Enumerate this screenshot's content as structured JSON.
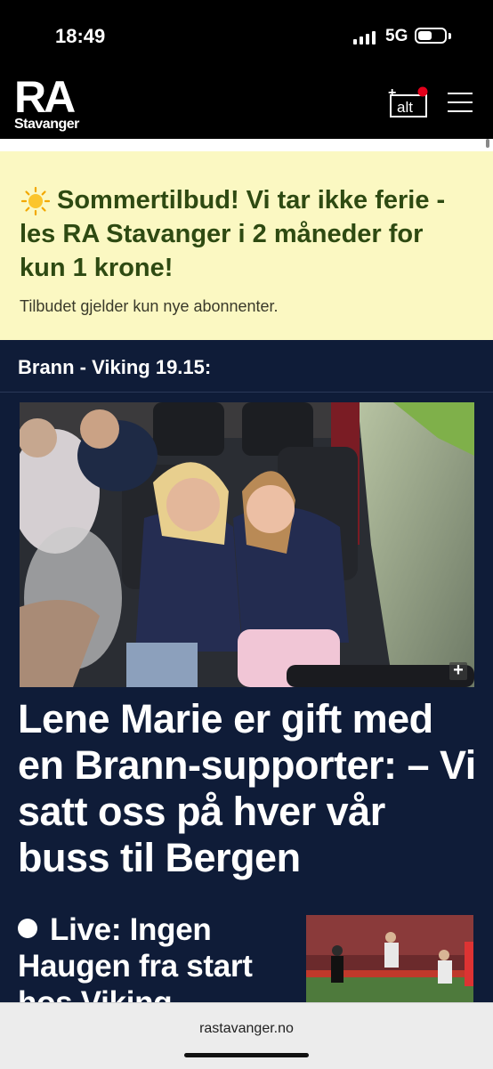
{
  "status_bar": {
    "time": "18:49",
    "network": "5G",
    "battery_level": 0.55
  },
  "header": {
    "logo_main": "RA",
    "logo_sub": "Stavanger",
    "alt_label": "alt",
    "alt_plus": "+",
    "menu_icon": "hamburger-menu-icon"
  },
  "promo": {
    "icon": "sun-icon",
    "title": "Sommertilbud! Vi tar ikke ferie - les RA Stavanger i 2 måneder for kun 1 krone!",
    "subtitle": "Tilbudet gjelder kun nye abonnenter.",
    "colors": {
      "background": "#fbf8c2",
      "title": "#2e4a12"
    }
  },
  "section": {
    "title": "Brann - Viking 19.15:",
    "background": "#0f1c38",
    "main_article": {
      "image": "photo-two-women-on-bus-in-viking-jerseys",
      "expand_icon": "+",
      "headline": "Lene Marie er gift med en Brann-supporter: – Vi satt oss på hver vår buss til Bergen"
    },
    "live_article": {
      "headline": "Live: Ingen Haugen fra start hos Viking",
      "image": "photo-football-match-action"
    }
  },
  "browser": {
    "url": "rastavanger.no"
  }
}
